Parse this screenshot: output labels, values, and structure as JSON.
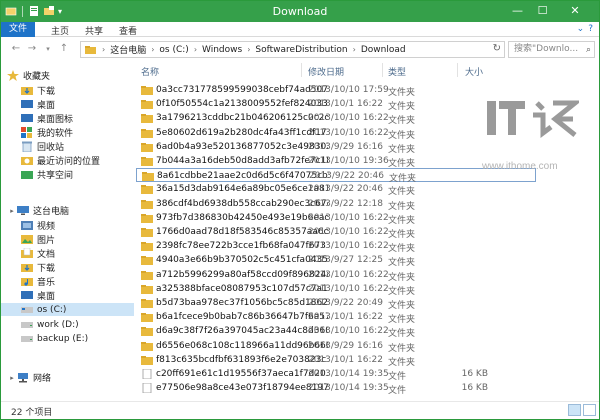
{
  "window": {
    "title": "Download",
    "controls": {
      "minimize": "—",
      "maximize": "☐",
      "close": "✕"
    }
  },
  "ribbon": {
    "tabs": [
      "文件",
      "主页",
      "共享",
      "查看"
    ],
    "help": "?"
  },
  "address": {
    "back": "←",
    "forward": "→",
    "up": "↑",
    "crumbs": [
      "这台电脑",
      "os (C:)",
      "Windows",
      "SoftwareDistribution",
      "Download"
    ],
    "refresh": "↻",
    "search_placeholder": "搜索\"Downlo...",
    "search_icon": "search-icon"
  },
  "colors": {
    "titlebar": "#35a04a",
    "accent": "#1e73c8",
    "folder": "#e8b93c"
  },
  "nav": {
    "favorites_label": "收藏夹",
    "favorites": [
      "下载",
      "桌面",
      "桌面图标",
      "我的软件",
      "回收站",
      "最近访问的位置",
      "共享空间"
    ],
    "thispc_label": "这台电脑",
    "thispc": [
      "视频",
      "图片",
      "文档",
      "下载",
      "音乐",
      "桌面"
    ],
    "drives": [
      "os (C:)",
      "work (D:)",
      "backup (E:)"
    ],
    "network_label": "网络"
  },
  "table": {
    "headers": {
      "name": "名称",
      "date": "修改日期",
      "type": "类型",
      "size": "大小"
    },
    "rows": [
      {
        "name": "0a3cc731778599599038cebf74ad5078",
        "date": "2013/10/10 17:59",
        "type": "文件夹",
        "size": "",
        "kind": "folder"
      },
      {
        "name": "0f10f50554c1a2138009552fef824033",
        "date": "2013/10/1 16:22",
        "type": "文件夹",
        "size": "",
        "kind": "folder"
      },
      {
        "name": "3a1796213cddbc21b046206125c0c2c1",
        "date": "2013/10/10 16:22",
        "type": "文件夹",
        "size": "",
        "kind": "folder"
      },
      {
        "name": "5e80602d619a2b280dc4fa43ff1cdf17",
        "date": "2013/10/10 16:22",
        "type": "文件夹",
        "size": "",
        "kind": "folder"
      },
      {
        "name": "6ad0b4a93e520136877052c3e4983020",
        "date": "2013/9/29 16:16",
        "type": "文件夹",
        "size": "",
        "kind": "folder"
      },
      {
        "name": "7b044a3a16deb50d8add3afb72fe7c18",
        "date": "2013/10/10 19:36",
        "type": "文件夹",
        "size": "",
        "kind": "folder"
      },
      {
        "name": "8a61cdbbe21aae2c0d6d5c6f47075cb5",
        "date": "2013/9/22 20:46",
        "type": "文件夹",
        "size": "",
        "kind": "folder"
      },
      {
        "name": "36a15d3dab9164e6a89bc05e6ce1a815",
        "date": "2013/9/22 20:46",
        "type": "文件夹",
        "size": "",
        "kind": "folder"
      },
      {
        "name": "386cdf4bd6938db558ccab290ec3c674",
        "date": "2013/9/22 12:18",
        "type": "文件夹",
        "size": "",
        "kind": "folder"
      },
      {
        "name": "973fb7d386830b42450e493e19b6eadc",
        "date": "2013/10/10 16:22",
        "type": "文件夹",
        "size": "",
        "kind": "folder"
      },
      {
        "name": "1766d0aad78d18f583546c85357aa6cc",
        "date": "2013/10/10 16:22",
        "type": "文件夹",
        "size": "",
        "kind": "folder"
      },
      {
        "name": "2398fc78ee722b3cce1fb68fa047f673",
        "date": "2013/10/10 16:22",
        "type": "文件夹",
        "size": "",
        "kind": "folder"
      },
      {
        "name": "4940a3e66b9b370502c5c451cfa0435d",
        "date": "2013/9/27 12:25",
        "type": "文件夹",
        "size": "",
        "kind": "folder"
      },
      {
        "name": "a712b5996299a80af58ccd09f896824a",
        "date": "2013/10/10 16:22",
        "type": "文件夹",
        "size": "",
        "kind": "folder"
      },
      {
        "name": "a325388bface08087953c107d57c7a10",
        "date": "2013/10/10 16:22",
        "type": "文件夹",
        "size": "",
        "kind": "folder"
      },
      {
        "name": "b5d73baa978ec37f1056bc5c85d18628",
        "date": "2013/9/22 20:49",
        "type": "文件夹",
        "size": "",
        "kind": "folder"
      },
      {
        "name": "b6a1fcece9b0bab7c86b36647b7f6a57",
        "date": "2013/10/1 16:22",
        "type": "文件夹",
        "size": "",
        "kind": "folder"
      },
      {
        "name": "d6a9c38f7f26a397045ac23a44c8d360",
        "date": "2013/10/10 16:22",
        "type": "文件夹",
        "size": "",
        "kind": "folder"
      },
      {
        "name": "d6556e068c108c118966a11dd96b6608",
        "date": "2013/9/29 16:16",
        "type": "文件夹",
        "size": "",
        "kind": "folder"
      },
      {
        "name": "f813c635bcdfbf631893f6e2e703823c",
        "date": "2013/10/1 16:22",
        "type": "文件夹",
        "size": "",
        "kind": "folder"
      },
      {
        "name": "c20ff691e61c1d19556f37aeca1f7d20...",
        "date": "2013/10/14 19:35",
        "type": "文件",
        "size": "16 KB",
        "kind": "file"
      },
      {
        "name": "e77506e98a8ce43e073f18794ee8197...",
        "date": "2013/10/14 19:35",
        "type": "文件",
        "size": "16 KB",
        "kind": "file"
      }
    ]
  },
  "watermark": {
    "logo_text": "IT之家",
    "url": "www.ithome.com"
  },
  "status": {
    "count": "22 个项目"
  }
}
